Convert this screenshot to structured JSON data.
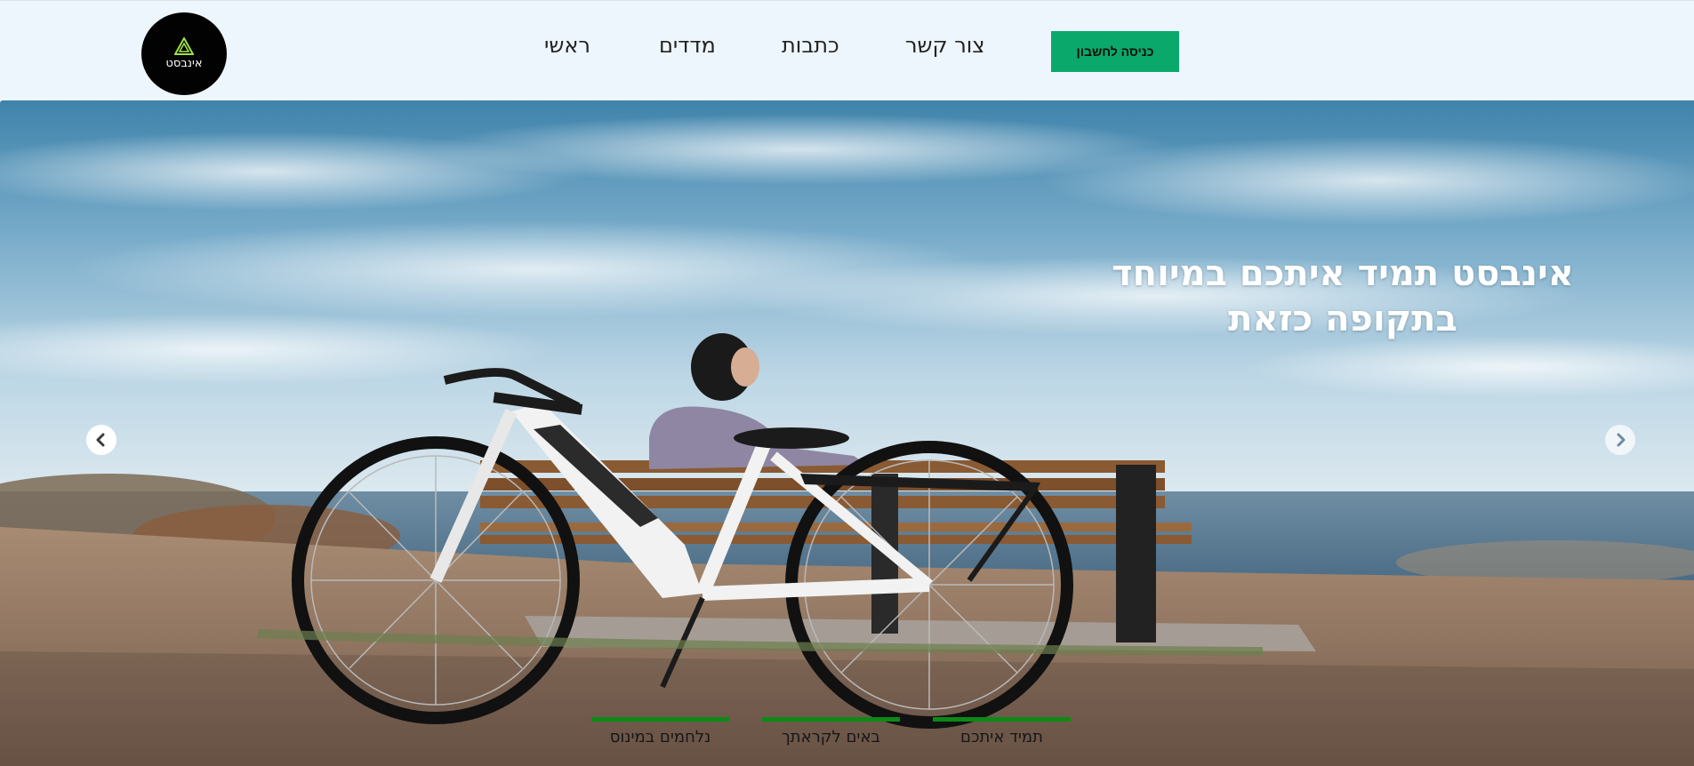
{
  "header": {
    "logo": {
      "text": "אינבסט",
      "icon": "triangle-logo-icon",
      "icon_color": "#9ee04a"
    },
    "nav": {
      "home": "ראשי",
      "indices": "מדדים",
      "articles": "כתבות",
      "contact": "צור קשר"
    },
    "login_button": "כניסה לחשבון"
  },
  "hero": {
    "title_line1": "אינבסט תמיד איתכם במיוחד",
    "title_line2": "בתקופה כזאת",
    "prev_icon": "chevron-left-icon",
    "next_icon": "chevron-right-icon",
    "slides": [
      {
        "label": "נלחמים במינוס"
      },
      {
        "label": "באים לקראתך"
      },
      {
        "label": "תמיד איתכם"
      }
    ]
  },
  "colors": {
    "header_bg": "#eef6fd",
    "accent_green": "#0aa86a",
    "indicator_green": "#0b8a17"
  }
}
